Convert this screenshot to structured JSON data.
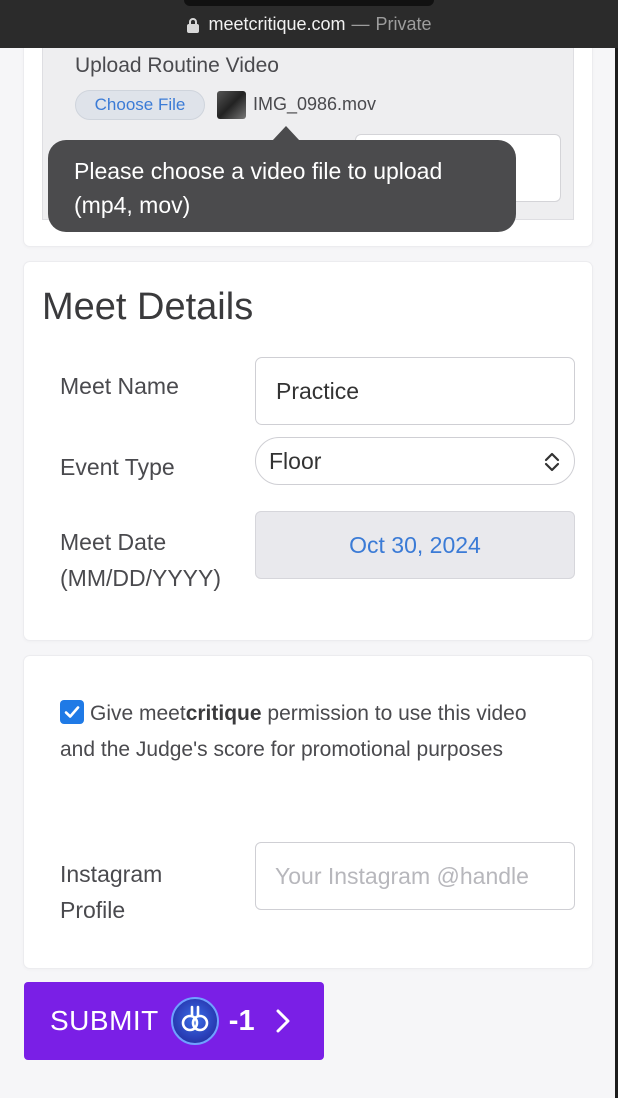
{
  "browser": {
    "url": "meetcritique.com",
    "separator": "—",
    "mode": "Private"
  },
  "upload": {
    "title": "Upload Routine Video",
    "choose_button": "Choose File",
    "file_name": "IMG_0986.mov",
    "tooltip": "Please choose a video file to upload (mp4, mov)"
  },
  "details": {
    "heading": "Meet Details",
    "meet_name_label": "Meet Name",
    "meet_name_value": "Practice",
    "event_type_label": "Event Type",
    "event_type_value": "Floor",
    "meet_date_label": "Meet Date",
    "meet_date_format": "(MM/DD/YYYY)",
    "meet_date_value": "Oct 30, 2024"
  },
  "permission": {
    "checked": true,
    "text_before": "Give meet",
    "brand_bold": "critique",
    "text_after": " permission to use this video and the Judge's score for promotional purposes",
    "instagram_label": "Instagram Profile",
    "instagram_placeholder": "Your Instagram @handle"
  },
  "submit": {
    "label": "SUBMIT",
    "cost": "-1",
    "icon": "coin-icon"
  },
  "colors": {
    "accent_purple": "#7a1fe6",
    "link_blue": "#3b7bd6",
    "checkbox_blue": "#1f7ae6"
  }
}
